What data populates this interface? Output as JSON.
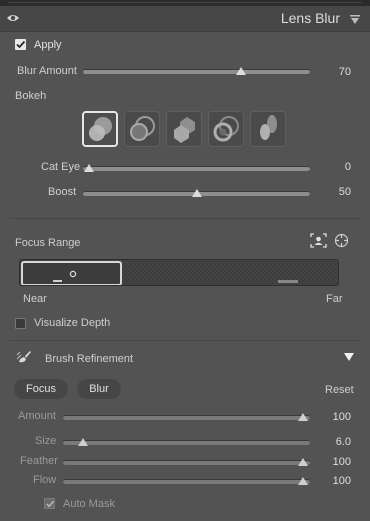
{
  "panel": {
    "title": "Lens Blur"
  },
  "apply": {
    "label": "Apply",
    "checked": true
  },
  "blur_amount": {
    "label": "Blur Amount",
    "value": "70"
  },
  "bokeh": {
    "label": "Bokeh",
    "shapes": [
      "circle",
      "soap-bubble",
      "blade",
      "ring",
      "cat-eye"
    ],
    "selected": "circle"
  },
  "cat_eye": {
    "label": "Cat Eye",
    "value": "0"
  },
  "boost": {
    "label": "Boost",
    "value": "50"
  },
  "focus_range": {
    "label": "Focus Range",
    "near_label": "Near",
    "far_label": "Far",
    "tool_icons": [
      "subject-focus-icon",
      "point-focus-icon"
    ]
  },
  "visualize_depth": {
    "label": "Visualize Depth",
    "checked": false
  },
  "brush_refinement": {
    "label": "Brush Refinement",
    "expanded": true,
    "focus_button": "Focus",
    "blur_button": "Blur",
    "reset_label": "Reset",
    "sliders": [
      {
        "label": "Amount",
        "value": "100"
      },
      {
        "label": "Size",
        "value": "6.0"
      },
      {
        "label": "Feather",
        "value": "100"
      },
      {
        "label": "Flow",
        "value": "100"
      }
    ],
    "auto_mask": {
      "label": "Auto Mask",
      "checked": true
    }
  }
}
